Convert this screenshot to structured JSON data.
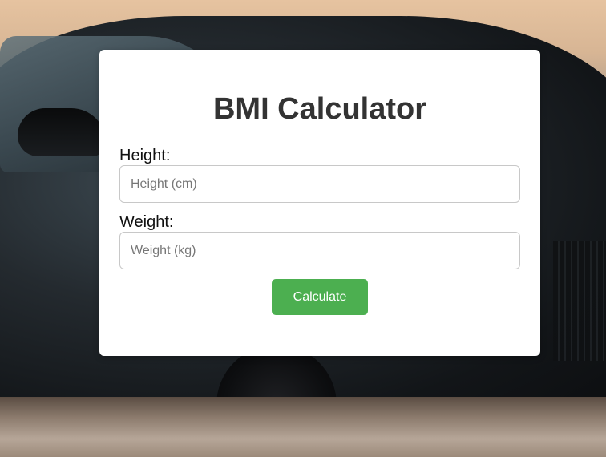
{
  "app": {
    "title": "BMI Calculator"
  },
  "form": {
    "height_label": "Height:",
    "height_placeholder": "Height (cm)",
    "height_value": "",
    "weight_label": "Weight:",
    "weight_placeholder": "Weight (kg)",
    "weight_value": "",
    "calculate_label": "Calculate"
  },
  "colors": {
    "accent": "#4caf50",
    "card_background": "#ffffff",
    "title_text": "#333333"
  }
}
